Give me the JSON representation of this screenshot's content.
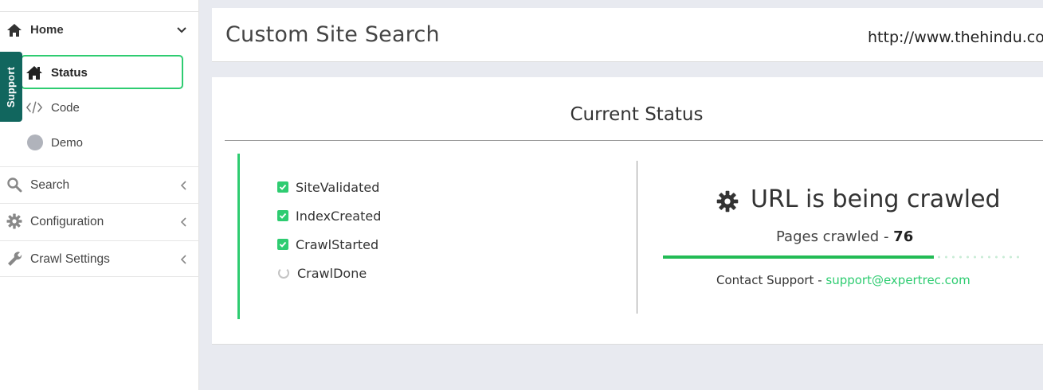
{
  "sidebar": {
    "support_tab": "Support",
    "home": {
      "label": "Home",
      "icon": "home-icon"
    },
    "sub_items": [
      {
        "label": "Status",
        "icon": "home-icon",
        "active": true
      },
      {
        "label": "Code",
        "icon": "code-icon"
      },
      {
        "label": "Demo",
        "icon": "circle-icon"
      }
    ],
    "items": [
      {
        "label": "Search",
        "icon": "search-icon"
      },
      {
        "label": "Configuration",
        "icon": "gear-icon"
      },
      {
        "label": "Crawl Settings",
        "icon": "wrench-icon"
      }
    ]
  },
  "header": {
    "title": "Custom Site Search",
    "site_url": "http://www.thehindu.co"
  },
  "status": {
    "title": "Current Status",
    "steps": [
      {
        "label": "SiteValidated",
        "done": true
      },
      {
        "label": "IndexCreated",
        "done": true
      },
      {
        "label": "CrawlStarted",
        "done": true
      },
      {
        "label": "CrawlDone",
        "done": false
      }
    ],
    "crawl_message": "URL is being crawled",
    "pages_label": "Pages crawled - ",
    "pages_count": "76",
    "progress_fraction": 0.76,
    "contact_label": "Contact Support - ",
    "contact_email": "support@expertrec.com"
  },
  "colors": {
    "accent": "#2ecc71",
    "support_tab": "#11665e"
  }
}
